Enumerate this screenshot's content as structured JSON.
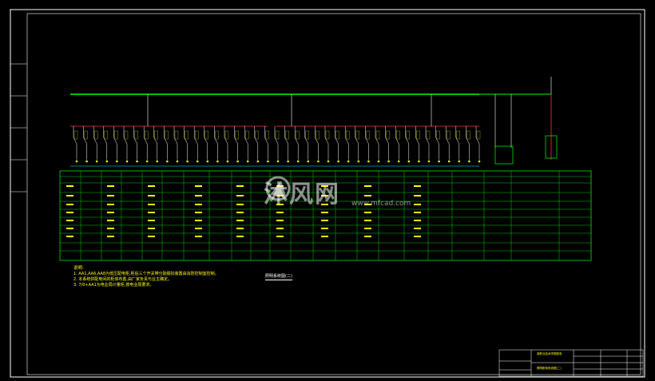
{
  "watermark": {
    "brand": "沐风网",
    "url": "www.mfcad.com"
  },
  "diagram": {
    "title": "照明系统图(二)",
    "notes_heading": "说明:",
    "notes": [
      "1. AA1,AA6,AA8为低压配电柜,柜后三个开关带分励脱扣装置由消防控制室控制。",
      "2. 本系统供配电间的柜体布置,由厂家负责与业主确定。",
      "3. 7/0+AA1为电业局计量柜,按电业局要求。"
    ]
  },
  "colors": {
    "background": "#000000",
    "frame": "#ffffff",
    "busbar": "#00ff00",
    "feeder": "#ff3030",
    "table": "#00ff00",
    "text": "#ffff00",
    "magenta": "#ff00ff",
    "cyan": "#00ffff"
  },
  "title_block": {
    "project": "某职业技术学院配电",
    "drawing": "照明配电系统图(二)"
  }
}
